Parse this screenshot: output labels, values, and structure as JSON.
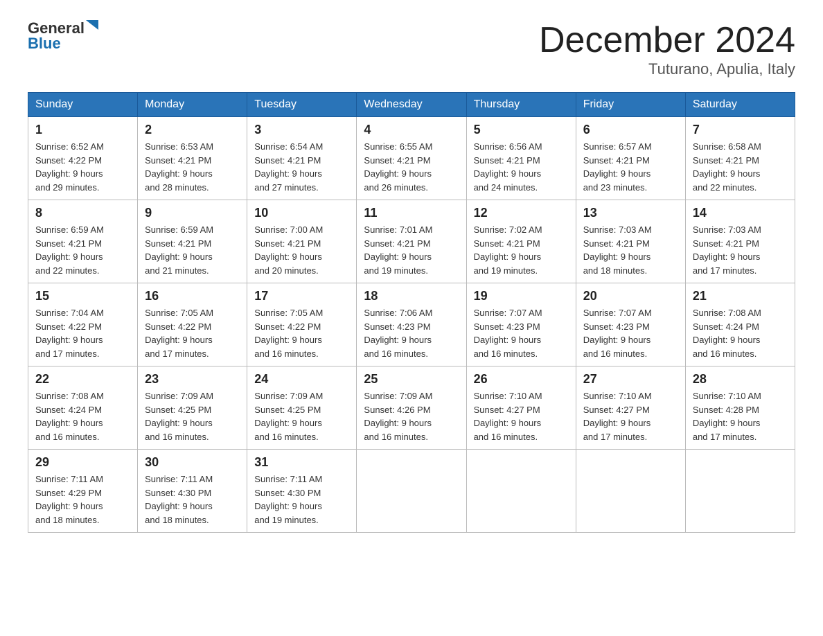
{
  "header": {
    "logo_general": "General",
    "logo_blue": "Blue",
    "month_title": "December 2024",
    "location": "Tuturano, Apulia, Italy"
  },
  "days_of_week": [
    "Sunday",
    "Monday",
    "Tuesday",
    "Wednesday",
    "Thursday",
    "Friday",
    "Saturday"
  ],
  "weeks": [
    [
      {
        "day": "1",
        "sunrise": "6:52 AM",
        "sunset": "4:22 PM",
        "daylight": "9 hours and 29 minutes."
      },
      {
        "day": "2",
        "sunrise": "6:53 AM",
        "sunset": "4:21 PM",
        "daylight": "9 hours and 28 minutes."
      },
      {
        "day": "3",
        "sunrise": "6:54 AM",
        "sunset": "4:21 PM",
        "daylight": "9 hours and 27 minutes."
      },
      {
        "day": "4",
        "sunrise": "6:55 AM",
        "sunset": "4:21 PM",
        "daylight": "9 hours and 26 minutes."
      },
      {
        "day": "5",
        "sunrise": "6:56 AM",
        "sunset": "4:21 PM",
        "daylight": "9 hours and 24 minutes."
      },
      {
        "day": "6",
        "sunrise": "6:57 AM",
        "sunset": "4:21 PM",
        "daylight": "9 hours and 23 minutes."
      },
      {
        "day": "7",
        "sunrise": "6:58 AM",
        "sunset": "4:21 PM",
        "daylight": "9 hours and 22 minutes."
      }
    ],
    [
      {
        "day": "8",
        "sunrise": "6:59 AM",
        "sunset": "4:21 PM",
        "daylight": "9 hours and 22 minutes."
      },
      {
        "day": "9",
        "sunrise": "6:59 AM",
        "sunset": "4:21 PM",
        "daylight": "9 hours and 21 minutes."
      },
      {
        "day": "10",
        "sunrise": "7:00 AM",
        "sunset": "4:21 PM",
        "daylight": "9 hours and 20 minutes."
      },
      {
        "day": "11",
        "sunrise": "7:01 AM",
        "sunset": "4:21 PM",
        "daylight": "9 hours and 19 minutes."
      },
      {
        "day": "12",
        "sunrise": "7:02 AM",
        "sunset": "4:21 PM",
        "daylight": "9 hours and 19 minutes."
      },
      {
        "day": "13",
        "sunrise": "7:03 AM",
        "sunset": "4:21 PM",
        "daylight": "9 hours and 18 minutes."
      },
      {
        "day": "14",
        "sunrise": "7:03 AM",
        "sunset": "4:21 PM",
        "daylight": "9 hours and 17 minutes."
      }
    ],
    [
      {
        "day": "15",
        "sunrise": "7:04 AM",
        "sunset": "4:22 PM",
        "daylight": "9 hours and 17 minutes."
      },
      {
        "day": "16",
        "sunrise": "7:05 AM",
        "sunset": "4:22 PM",
        "daylight": "9 hours and 17 minutes."
      },
      {
        "day": "17",
        "sunrise": "7:05 AM",
        "sunset": "4:22 PM",
        "daylight": "9 hours and 16 minutes."
      },
      {
        "day": "18",
        "sunrise": "7:06 AM",
        "sunset": "4:23 PM",
        "daylight": "9 hours and 16 minutes."
      },
      {
        "day": "19",
        "sunrise": "7:07 AM",
        "sunset": "4:23 PM",
        "daylight": "9 hours and 16 minutes."
      },
      {
        "day": "20",
        "sunrise": "7:07 AM",
        "sunset": "4:23 PM",
        "daylight": "9 hours and 16 minutes."
      },
      {
        "day": "21",
        "sunrise": "7:08 AM",
        "sunset": "4:24 PM",
        "daylight": "9 hours and 16 minutes."
      }
    ],
    [
      {
        "day": "22",
        "sunrise": "7:08 AM",
        "sunset": "4:24 PM",
        "daylight": "9 hours and 16 minutes."
      },
      {
        "day": "23",
        "sunrise": "7:09 AM",
        "sunset": "4:25 PM",
        "daylight": "9 hours and 16 minutes."
      },
      {
        "day": "24",
        "sunrise": "7:09 AM",
        "sunset": "4:25 PM",
        "daylight": "9 hours and 16 minutes."
      },
      {
        "day": "25",
        "sunrise": "7:09 AM",
        "sunset": "4:26 PM",
        "daylight": "9 hours and 16 minutes."
      },
      {
        "day": "26",
        "sunrise": "7:10 AM",
        "sunset": "4:27 PM",
        "daylight": "9 hours and 16 minutes."
      },
      {
        "day": "27",
        "sunrise": "7:10 AM",
        "sunset": "4:27 PM",
        "daylight": "9 hours and 17 minutes."
      },
      {
        "day": "28",
        "sunrise": "7:10 AM",
        "sunset": "4:28 PM",
        "daylight": "9 hours and 17 minutes."
      }
    ],
    [
      {
        "day": "29",
        "sunrise": "7:11 AM",
        "sunset": "4:29 PM",
        "daylight": "9 hours and 18 minutes."
      },
      {
        "day": "30",
        "sunrise": "7:11 AM",
        "sunset": "4:30 PM",
        "daylight": "9 hours and 18 minutes."
      },
      {
        "day": "31",
        "sunrise": "7:11 AM",
        "sunset": "4:30 PM",
        "daylight": "9 hours and 19 minutes."
      },
      null,
      null,
      null,
      null
    ]
  ]
}
